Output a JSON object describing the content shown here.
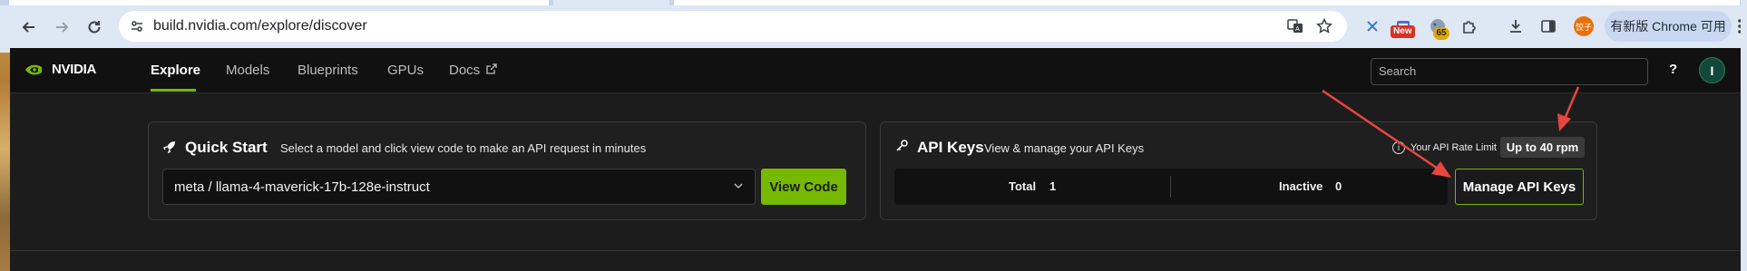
{
  "browser": {
    "url": "build.nvidia.com/explore/discover",
    "badge_new": "New",
    "badge_count": "65",
    "profile_label": "饺子",
    "update_label": "有新版 Chrome 可用"
  },
  "nav": {
    "logo_text": "NVIDIA",
    "links": [
      "Explore",
      "Models",
      "Blueprints",
      "GPUs",
      "Docs"
    ],
    "search_placeholder": "Search",
    "help": "?",
    "avatar": "I"
  },
  "quick_start": {
    "title": "Quick Start",
    "subtitle": "Select a model and click view code to make an API request in minutes",
    "selected_model": "meta / llama-4-maverick-17b-128e-instruct",
    "view_code_label": "View Code"
  },
  "api_keys": {
    "title": "API Keys",
    "subtitle": "View & manage your API Keys",
    "rate_limit_label": "Your API Rate Limit",
    "rate_limit_value": "Up to 40 rpm",
    "total_label": "Total",
    "total_value": "1",
    "inactive_label": "Inactive",
    "inactive_value": "0",
    "manage_label": "Manage API Keys"
  },
  "colors": {
    "accent": "#76b900",
    "annotation_arrow": "#e8473f"
  }
}
